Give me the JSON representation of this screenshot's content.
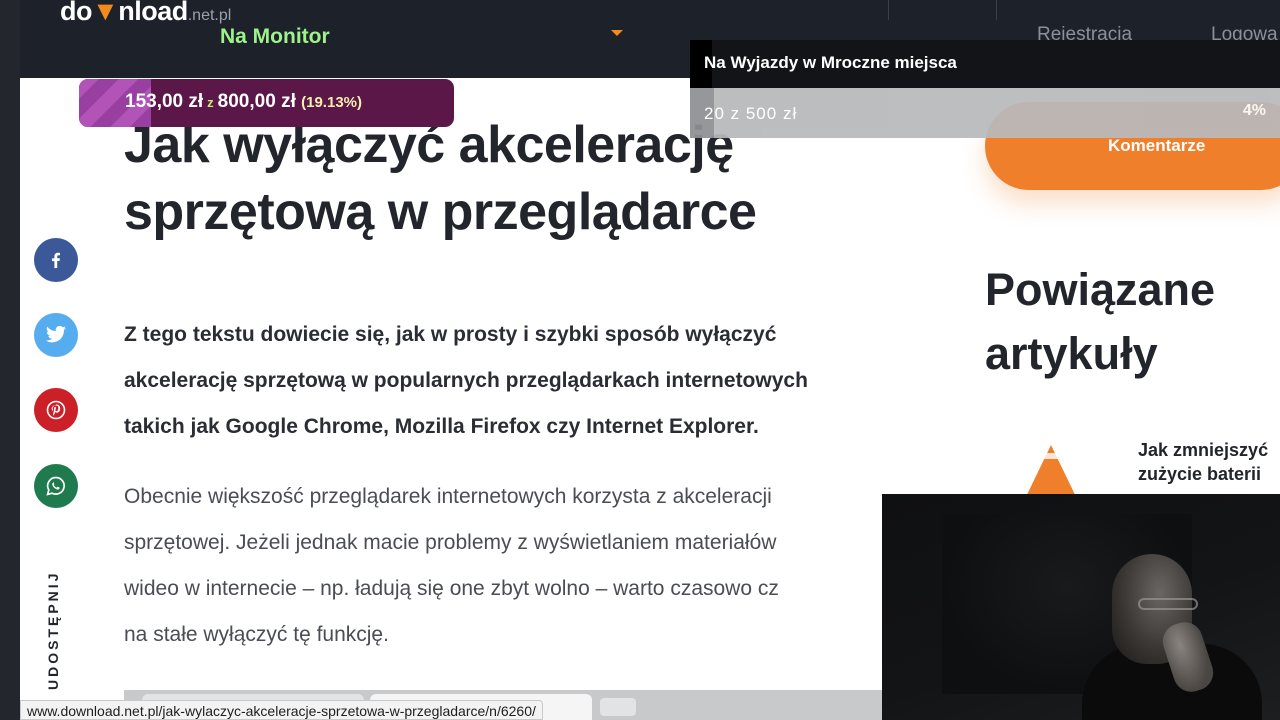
{
  "header": {
    "logo": {
      "prefix": "do",
      "mid": "nload",
      "suffix": ".net.pl"
    },
    "overlay_title": "Na Monitor",
    "nav": {
      "register": "Rejestracja",
      "login": "Logowa"
    }
  },
  "donation": {
    "raised": "153,00 zł",
    "of": "z",
    "goal": "800,00 zł",
    "percent_label": "(19.13%)",
    "progress": 0.1913
  },
  "goal_widget": {
    "title": "Na Wyjazdy w Mroczne miejsca",
    "amount": "20 z 500 zł",
    "percent_label": "4%",
    "progress": 0.04
  },
  "article": {
    "title_line1": "Jak wyłączyć akcelerację",
    "title_line2": "sprzętową w przeglądarce",
    "lead_line1": "Z tego tekstu dowiecie się, jak w prosty i szybki sposób wyłączyć",
    "lead_line2": "akcelerację sprzętową w popularnych przeglądarkach internetowych",
    "lead_line3": "takich jak Google Chrome, Mozilla Firefox czy Internet Explorer.",
    "body_line1": "Obecnie większość przeglądarek internetowych korzysta z akceleracji",
    "body_line2": "sprzętowej. Jeżeli jednak macie problemy z wyświetlaniem materiałów",
    "body_line3": "wideo w internecie – np. ładują się one zbyt wolno – warto czasowo cz",
    "body_line4": "na stałe wyłączyć tę funkcję."
  },
  "social": {
    "share_label": "UDOSTĘPNIJ",
    "buttons": [
      {
        "icon": "facebook-icon",
        "color": "#3b5998"
      },
      {
        "icon": "twitter-icon",
        "color": "#55acee"
      },
      {
        "icon": "pinterest-icon",
        "color": "#cb2027"
      },
      {
        "icon": "whatsapp-icon",
        "color": "#1f7a4d"
      }
    ]
  },
  "sidebar": {
    "comments_label": "Komentarze",
    "related_heading_line1": "Powiązane",
    "related_heading_line2": "artykuły",
    "related_item_line1": "Jak zmniejszyć",
    "related_item_line2": "zużycie baterii",
    "related_item_icon": "vlc-cone-icon"
  },
  "status_bar": {
    "url": "www.download.net.pl/jak-wylaczyc-akceleracje-sprzetowa-w-przegladarce/n/6260/"
  },
  "colors": {
    "accent_orange": "#f07f2b",
    "header_bg": "#1d2129",
    "overlay_green": "#9ef28b",
    "donation_bg": "#5a1748",
    "donation_fill": "#b253b8"
  }
}
